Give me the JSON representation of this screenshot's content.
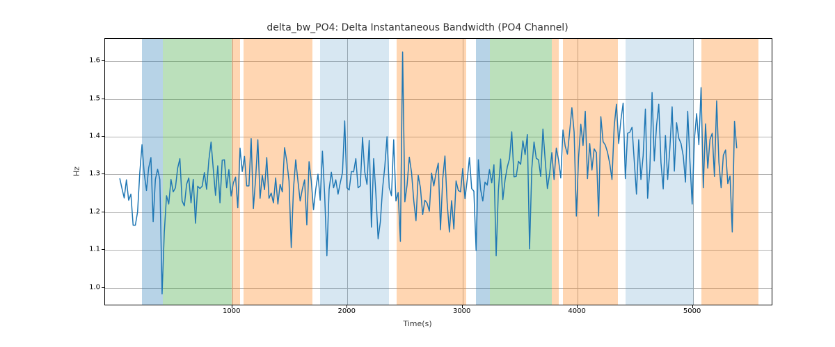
{
  "chart_data": {
    "type": "line",
    "title": "delta_bw_PO4: Delta Instantaneous Bandwidth (PO4 Channel)",
    "xlabel": "Time(s)",
    "ylabel": "Hz",
    "xlim": [
      -104.7,
      5697.4
    ],
    "ylim": [
      0.952,
      1.659
    ],
    "xticks": [
      1000,
      2000,
      3000,
      4000,
      5000
    ],
    "yticks": [
      1.0,
      1.1,
      1.2,
      1.3,
      1.4,
      1.5,
      1.6
    ],
    "spans": [
      {
        "x0": 215,
        "x1": 394,
        "color": "#1f77b4",
        "label": "blue"
      },
      {
        "x0": 394,
        "x1": 996,
        "color": "#2ca02c",
        "label": "green"
      },
      {
        "x0": 996,
        "x1": 1069,
        "color": "#ff7f0e",
        "label": "orange"
      },
      {
        "x0": 1100,
        "x1": 1695,
        "color": "#ff7f0e",
        "label": "orange"
      },
      {
        "x0": 1760,
        "x1": 2360,
        "color": "#1f77b4",
        "label": "blue",
        "alpha_mult": 0.55
      },
      {
        "x0": 2430,
        "x1": 3030,
        "color": "#ff7f0e",
        "label": "orange"
      },
      {
        "x0": 3115,
        "x1": 3235,
        "color": "#1f77b4",
        "label": "blue"
      },
      {
        "x0": 3235,
        "x1": 3775,
        "color": "#2ca02c",
        "label": "green"
      },
      {
        "x0": 3775,
        "x1": 3835,
        "color": "#ff7f0e",
        "label": "orange"
      },
      {
        "x0": 3875,
        "x1": 4350,
        "color": "#ff7f0e",
        "label": "orange"
      },
      {
        "x0": 4415,
        "x1": 5010,
        "color": "#1f77b4",
        "label": "blue",
        "alpha_mult": 0.55
      },
      {
        "x0": 5075,
        "x1": 5570,
        "color": "#ff7f0e",
        "label": "orange"
      }
    ],
    "series": [
      {
        "name": "delta_bw_PO4",
        "color": "#1f77b4",
        "x": [
          22.8,
          42.1,
          61.5,
          80.8,
          100.2,
          119.5,
          138.9,
          158.2,
          177.6,
          196.9,
          216.2,
          235.6,
          254.9,
          274.3,
          293.6,
          313.0,
          332.3,
          351.7,
          371.0,
          390.4,
          409.7,
          429.1,
          448.4,
          467.7,
          487.1,
          506.4,
          525.8,
          545.1,
          564.5,
          583.8,
          603.2,
          622.5,
          641.9,
          661.2,
          680.6,
          699.9,
          719.2,
          738.6,
          757.9,
          777.3,
          796.6,
          816.0,
          835.3,
          854.7,
          874.0,
          893.4,
          912.7,
          932.0,
          951.4,
          970.7,
          990.1,
          1009.4,
          1028.8,
          1048.1,
          1067.5,
          1086.8,
          1106.2,
          1125.5,
          1144.9,
          1164.2,
          1183.5,
          1202.9,
          1222.2,
          1241.6,
          1260.9,
          1280.3,
          1299.6,
          1319.0,
          1338.3,
          1357.7,
          1377.0,
          1396.4,
          1415.7,
          1435.0,
          1454.4,
          1473.7,
          1493.1,
          1512.4,
          1531.8,
          1551.1,
          1570.5,
          1589.8,
          1609.2,
          1628.5,
          1647.8,
          1667.2,
          1686.5,
          1705.9,
          1725.2,
          1744.6,
          1763.9,
          1783.3,
          1802.6,
          1822.0,
          1841.3,
          1860.7,
          1880.0,
          1899.3,
          1918.7,
          1938.0,
          1957.4,
          1976.7,
          1996.1,
          2015.4,
          2034.8,
          2054.1,
          2073.5,
          2092.8,
          2112.1,
          2131.5,
          2150.8,
          2170.2,
          2189.5,
          2208.9,
          2228.2,
          2247.6,
          2266.9,
          2286.3,
          2305.6,
          2325.0,
          2344.3,
          2363.6,
          2383.0,
          2402.3,
          2421.7,
          2441.0,
          2460.4,
          2479.7,
          2499.1,
          2518.4,
          2537.8,
          2557.1,
          2576.5,
          2595.8,
          2615.1,
          2634.5,
          2653.8,
          2673.2,
          2692.5,
          2711.9,
          2731.2,
          2750.6,
          2769.9,
          2789.3,
          2808.6,
          2827.9,
          2847.3,
          2866.6,
          2886.0,
          2905.3,
          2924.7,
          2944.0,
          2963.4,
          2982.7,
          3002.1,
          3021.4,
          3040.8,
          3060.1,
          3079.4,
          3098.8,
          3118.1,
          3137.5,
          3156.8,
          3176.2,
          3195.5,
          3214.9,
          3234.2,
          3253.6,
          3272.9,
          3292.2,
          3311.6,
          3330.9,
          3350.3,
          3369.6,
          3389.0,
          3408.3,
          3427.7,
          3447.0,
          3466.4,
          3485.7,
          3505.1,
          3524.4,
          3543.7,
          3563.1,
          3582.4,
          3601.8,
          3621.1,
          3640.5,
          3659.8,
          3679.2,
          3698.5,
          3717.9,
          3737.2,
          3756.5,
          3775.9,
          3795.2,
          3814.6,
          3833.9,
          3853.3,
          3872.6,
          3892.0,
          3911.3,
          3930.7,
          3950.0,
          3969.4,
          3988.7,
          4008.0,
          4027.4,
          4046.7,
          4066.1,
          4085.4,
          4104.8,
          4124.1,
          4143.5,
          4162.8,
          4182.2,
          4201.5,
          4220.8,
          4240.2,
          4259.5,
          4278.9,
          4298.2,
          4317.6,
          4336.9,
          4356.3,
          4375.6,
          4395.0,
          4414.3,
          4433.7,
          4453.0,
          4472.3,
          4491.7,
          4511.0,
          4530.4,
          4549.7,
          4569.1,
          4588.4,
          4607.8,
          4627.1,
          4646.5,
          4665.8,
          4685.2,
          4704.5,
          4723.8,
          4743.2,
          4762.5,
          4781.9,
          4801.2,
          4820.6,
          4839.9,
          4859.3,
          4878.6,
          4898.0,
          4917.3,
          4936.6,
          4956.0,
          4975.3,
          4994.7,
          5014.0,
          5033.4,
          5052.7,
          5072.1,
          5091.4,
          5110.8,
          5130.1,
          5149.5,
          5168.8,
          5188.1,
          5207.5,
          5226.8,
          5246.2,
          5265.5,
          5284.9,
          5304.2,
          5323.6,
          5342.9,
          5362.3,
          5381.6,
          5400.9,
          5420.3,
          5439.6,
          5459.0,
          5478.3,
          5497.7,
          5517.0,
          5536.4,
          5555.7,
          5569.7
        ],
        "y": [
          1.29,
          1.263,
          1.238,
          1.286,
          1.232,
          1.248,
          1.166,
          1.166,
          1.201,
          1.305,
          1.379,
          1.302,
          1.258,
          1.318,
          1.345,
          1.175,
          1.287,
          1.314,
          1.287,
          0.984,
          1.147,
          1.244,
          1.222,
          1.287,
          1.254,
          1.265,
          1.317,
          1.342,
          1.23,
          1.217,
          1.274,
          1.291,
          1.225,
          1.287,
          1.171,
          1.269,
          1.263,
          1.269,
          1.305,
          1.261,
          1.338,
          1.386,
          1.314,
          1.245,
          1.323,
          1.225,
          1.338,
          1.339,
          1.265,
          1.313,
          1.243,
          1.278,
          1.293,
          1.212,
          1.37,
          1.308,
          1.348,
          1.27,
          1.27,
          1.395,
          1.21,
          1.289,
          1.392,
          1.237,
          1.298,
          1.26,
          1.345,
          1.237,
          1.251,
          1.225,
          1.291,
          1.222,
          1.274,
          1.254,
          1.371,
          1.335,
          1.283,
          1.107,
          1.262,
          1.339,
          1.283,
          1.23,
          1.262,
          1.286,
          1.167,
          1.334,
          1.283,
          1.207,
          1.261,
          1.301,
          1.232,
          1.362,
          1.246,
          1.085,
          1.261,
          1.306,
          1.265,
          1.286,
          1.248,
          1.278,
          1.305,
          1.442,
          1.265,
          1.259,
          1.308,
          1.307,
          1.342,
          1.265,
          1.27,
          1.398,
          1.307,
          1.274,
          1.39,
          1.161,
          1.342,
          1.248,
          1.13,
          1.175,
          1.263,
          1.321,
          1.4,
          1.265,
          1.244,
          1.392,
          1.23,
          1.252,
          1.123,
          1.624,
          1.228,
          1.272,
          1.346,
          1.306,
          1.231,
          1.178,
          1.298,
          1.265,
          1.194,
          1.232,
          1.224,
          1.203,
          1.304,
          1.27,
          1.304,
          1.33,
          1.154,
          1.288,
          1.349,
          1.225,
          1.148,
          1.231,
          1.156,
          1.283,
          1.258,
          1.254,
          1.316,
          1.236,
          1.286,
          1.345,
          1.263,
          1.256,
          1.099,
          1.339,
          1.261,
          1.23,
          1.28,
          1.272,
          1.313,
          1.278,
          1.326,
          1.085,
          1.258,
          1.341,
          1.234,
          1.286,
          1.32,
          1.342,
          1.413,
          1.294,
          1.295,
          1.335,
          1.327,
          1.389,
          1.353,
          1.406,
          1.103,
          1.316,
          1.386,
          1.343,
          1.339,
          1.295,
          1.42,
          1.339,
          1.263,
          1.302,
          1.358,
          1.287,
          1.37,
          1.339,
          1.291,
          1.418,
          1.375,
          1.354,
          1.414,
          1.477,
          1.412,
          1.19,
          1.345,
          1.433,
          1.377,
          1.467,
          1.289,
          1.382,
          1.312,
          1.368,
          1.358,
          1.19,
          1.453,
          1.387,
          1.378,
          1.359,
          1.329,
          1.287,
          1.428,
          1.486,
          1.382,
          1.444,
          1.489,
          1.289,
          1.409,
          1.412,
          1.425,
          1.336,
          1.248,
          1.392,
          1.287,
          1.35,
          1.473,
          1.237,
          1.314,
          1.517,
          1.336,
          1.429,
          1.486,
          1.331,
          1.262,
          1.403,
          1.287,
          1.371,
          1.479,
          1.309,
          1.437,
          1.396,
          1.382,
          1.349,
          1.28,
          1.467,
          1.335,
          1.222,
          1.393,
          1.461,
          1.379,
          1.53,
          1.265,
          1.434,
          1.317,
          1.393,
          1.409,
          1.295,
          1.495,
          1.333,
          1.265,
          1.351,
          1.365,
          1.276,
          1.296,
          1.148,
          1.441,
          1.37
        ]
      }
    ]
  }
}
